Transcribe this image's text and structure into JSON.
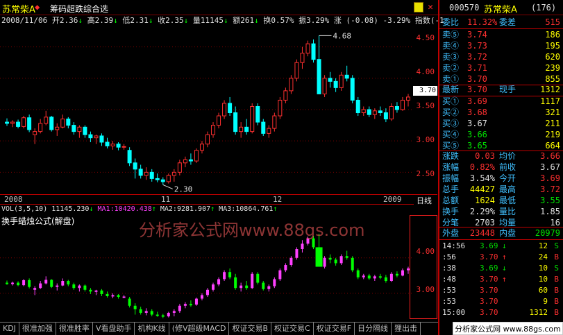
{
  "header": {
    "title": "苏常柴A",
    "arrow": "◆",
    "subtitle": "筹码超跌综合选"
  },
  "info": {
    "date": "2008/11/06",
    "open": "开2.36",
    "high": "高2.39",
    "low": "低2.31",
    "close": "收2.35",
    "volume": "量11145",
    "amount": "额261",
    "turnover": "换0.57%",
    "amplitude": "振3.29%",
    "change": "涨 (-0.08) -3.29%",
    "index": "指数(-1"
  },
  "price_axis": [
    "4.50",
    "4.00",
    "3.50",
    "3.00",
    "2.50"
  ],
  "annotations": {
    "high": "4.68",
    "low": "2.30",
    "current_tag": "3.70"
  },
  "date_axis": [
    "2008",
    "11",
    "12",
    "2009"
  ],
  "date_period": "日线",
  "vol_line": {
    "title": "VOL(3,5,10)",
    "vol": "11145.230",
    "ma1": "MA1:10420.438",
    "ma2": "MA2:9281.907",
    "ma3": "MA3:10864.761"
  },
  "indicator": {
    "label": "换手蜡烛公式(解盘)",
    "watermark": "分析家公式网www.88gs.com",
    "axis": [
      "4.00",
      "3.00"
    ]
  },
  "tabs": [
    "KDJ",
    "很准加强",
    "很准胜率",
    "V看盘助手",
    "机构K线",
    "(修V超级MACD",
    "权证交易B",
    "权证交易C",
    "权证交易F",
    "日分隔线",
    "狸出击"
  ],
  "side": {
    "code": "000570",
    "name": "苏常柴A",
    "count": "(176)",
    "weibi": {
      "label": "委比",
      "pct": "11.32%",
      "label2": "委差",
      "value": "515"
    },
    "asks": [
      {
        "label": "卖⑤",
        "price": "3.74",
        "vol": "186"
      },
      {
        "label": "卖④",
        "price": "3.73",
        "vol": "195"
      },
      {
        "label": "卖③",
        "price": "3.72",
        "vol": "620"
      },
      {
        "label": "卖②",
        "price": "3.71",
        "vol": "239"
      },
      {
        "label": "卖①",
        "price": "3.70",
        "vol": "855"
      }
    ],
    "last": {
      "label": "最新",
      "price": "3.70",
      "label2": "现手",
      "vol": "1312"
    },
    "bids": [
      {
        "label": "买①",
        "price": "3.69",
        "vol": "1117"
      },
      {
        "label": "买②",
        "price": "3.68",
        "vol": "321"
      },
      {
        "label": "买③",
        "price": "3.67",
        "vol": "211"
      },
      {
        "label": "买④",
        "price": "3.66",
        "vol": "219"
      },
      {
        "label": "买⑤",
        "price": "3.65",
        "vol": "664"
      }
    ],
    "stats": [
      {
        "l1": "涨跌",
        "v1": "0.03",
        "l2": "均价",
        "v2": "3.66"
      },
      {
        "l1": "涨幅",
        "v1": "0.82%",
        "l2": "前收",
        "v2": "3.67"
      },
      {
        "l1": "振幅",
        "v1": "3.54%",
        "l2": "今开",
        "v2": "3.69"
      },
      {
        "l1": "总手",
        "v1": "44427",
        "l2": "最高",
        "v2": "3.72"
      },
      {
        "l1": "总额",
        "v1": "1624",
        "l2": "最低",
        "v2": "3.55"
      },
      {
        "l1": "换手",
        "v1": "2.29%",
        "l2": "量比",
        "v2": "1.85"
      },
      {
        "l1": "分笔",
        "v1": "2703",
        "l2": "均量",
        "v2": "16"
      }
    ],
    "outer": {
      "l1": "外盘",
      "v1": "23448",
      "l2": "内盘",
      "v2": "20979"
    },
    "ticks": [
      {
        "t": "14:56",
        "p": "3.69",
        "d": "↓",
        "v": "12",
        "s": "S"
      },
      {
        "t": ":56",
        "p": "3.70",
        "d": "↑",
        "v": "24",
        "s": "B"
      },
      {
        "t": ":38",
        "p": "3.69",
        "d": "↓",
        "v": "10",
        "s": "S"
      },
      {
        "t": ":48",
        "p": "3.70",
        "d": "↑",
        "v": "10",
        "s": "B"
      },
      {
        "t": ":53",
        "p": "3.70",
        "d": "",
        "v": "60",
        "s": "B"
      },
      {
        "t": ":53",
        "p": "3.70",
        "d": "",
        "v": "9",
        "s": "B"
      },
      {
        "t": "15:00",
        "p": "3.70",
        "d": "",
        "v": "1312",
        "s": "B"
      }
    ],
    "site": "分析家公式网 www.88gs.com"
  },
  "chart_data": {
    "type": "candlestick",
    "y_axis_ticks": [
      2.5,
      3.0,
      3.5,
      4.0,
      4.5
    ],
    "ylim": [
      2.15,
      4.85
    ],
    "date_labels": [
      "2008",
      "11",
      "12",
      "2009"
    ],
    "candles": [
      [
        3.3,
        3.36,
        3.24,
        3.28
      ],
      [
        3.28,
        3.33,
        3.22,
        3.3
      ],
      [
        3.3,
        3.34,
        3.2,
        3.23
      ],
      [
        3.23,
        3.4,
        3.2,
        3.37
      ],
      [
        3.37,
        3.42,
        3.14,
        3.18
      ],
      [
        3.1,
        3.2,
        2.95,
        3.15
      ],
      [
        3.15,
        3.35,
        3.12,
        3.28
      ],
      [
        3.28,
        3.48,
        3.25,
        3.38
      ],
      [
        3.38,
        3.4,
        3.15,
        3.18
      ],
      [
        3.18,
        3.28,
        3.08,
        3.22
      ],
      [
        3.22,
        3.42,
        3.2,
        3.35
      ],
      [
        3.35,
        3.38,
        3.2,
        3.25
      ],
      [
        3.25,
        3.3,
        3.1,
        3.15
      ],
      [
        3.15,
        3.25,
        3.05,
        3.22
      ],
      [
        3.22,
        3.25,
        3.05,
        3.1
      ],
      [
        3.1,
        3.15,
        2.98,
        3.05
      ],
      [
        3.05,
        3.1,
        2.95,
        3.08
      ],
      [
        3.08,
        3.12,
        2.92,
        2.98
      ],
      [
        2.98,
        3.05,
        2.88,
        2.92
      ],
      [
        2.92,
        3.0,
        2.86,
        2.95
      ],
      [
        2.95,
        2.98,
        2.85,
        2.9
      ],
      [
        2.9,
        2.95,
        2.86,
        2.91
      ],
      [
        2.85,
        2.9,
        2.6,
        2.65
      ],
      [
        2.65,
        2.72,
        2.4,
        2.55
      ],
      [
        2.55,
        2.62,
        2.4,
        2.45
      ],
      [
        2.45,
        2.58,
        2.38,
        2.5
      ],
      [
        2.5,
        2.55,
        2.35,
        2.4
      ],
      [
        2.4,
        2.48,
        2.34,
        2.38
      ],
      [
        2.38,
        2.42,
        2.3,
        2.35
      ],
      [
        2.35,
        2.48,
        2.32,
        2.45
      ],
      [
        2.45,
        2.55,
        2.35,
        2.5
      ],
      [
        2.5,
        2.7,
        2.45,
        2.65
      ],
      [
        2.65,
        2.75,
        2.58,
        2.7
      ],
      [
        2.7,
        2.8,
        2.62,
        2.68
      ],
      [
        2.68,
        2.88,
        2.65,
        2.85
      ],
      [
        2.85,
        3.0,
        2.8,
        2.95
      ],
      [
        2.95,
        3.15,
        2.9,
        3.1
      ],
      [
        3.1,
        3.3,
        3.05,
        3.25
      ],
      [
        3.25,
        3.45,
        3.2,
        3.4
      ],
      [
        3.4,
        3.65,
        3.35,
        3.6
      ],
      [
        3.6,
        3.7,
        3.4,
        3.45
      ],
      [
        3.45,
        3.55,
        3.1,
        3.15
      ],
      [
        3.15,
        3.3,
        3.05,
        3.22
      ],
      [
        3.22,
        3.35,
        3.1,
        3.15
      ],
      [
        3.15,
        3.6,
        3.12,
        3.55
      ],
      [
        3.55,
        3.6,
        3.25,
        3.3
      ],
      [
        3.3,
        3.35,
        3.08,
        3.12
      ],
      [
        3.12,
        3.25,
        3.05,
        3.2
      ],
      [
        3.2,
        3.45,
        3.15,
        3.4
      ],
      [
        3.4,
        3.7,
        3.35,
        3.65
      ],
      [
        3.65,
        3.85,
        3.6,
        3.8
      ],
      [
        3.8,
        4.05,
        3.75,
        4.0
      ],
      [
        4.0,
        4.3,
        3.95,
        4.25
      ],
      [
        4.25,
        4.5,
        4.15,
        4.4
      ],
      [
        4.4,
        4.6,
        4.35,
        4.55
      ],
      [
        4.55,
        4.62,
        4.25,
        4.3
      ],
      [
        4.3,
        4.68,
        4.25,
        3.75
      ],
      [
        3.75,
        4.05,
        3.7,
        4.0
      ],
      [
        4.0,
        4.1,
        3.85,
        3.95
      ],
      [
        3.95,
        4.0,
        3.78,
        3.85
      ],
      [
        3.85,
        4.1,
        3.8,
        4.05
      ],
      [
        4.05,
        4.2,
        3.95,
        4.0
      ],
      [
        4.0,
        4.05,
        3.6,
        3.65
      ],
      [
        3.65,
        3.7,
        3.4,
        3.45
      ],
      [
        3.45,
        3.55,
        3.4,
        3.5
      ],
      [
        3.5,
        3.55,
        3.38,
        3.42
      ],
      [
        3.42,
        3.52,
        3.35,
        3.48
      ],
      [
        3.48,
        3.55,
        3.4,
        3.45
      ],
      [
        3.45,
        3.52,
        3.3,
        3.35
      ],
      [
        3.35,
        3.6,
        3.32,
        3.55
      ],
      [
        3.55,
        3.62,
        3.45,
        3.5
      ],
      [
        3.5,
        3.7,
        3.48,
        3.65
      ],
      [
        3.65,
        3.75,
        3.55,
        3.7
      ]
    ]
  }
}
